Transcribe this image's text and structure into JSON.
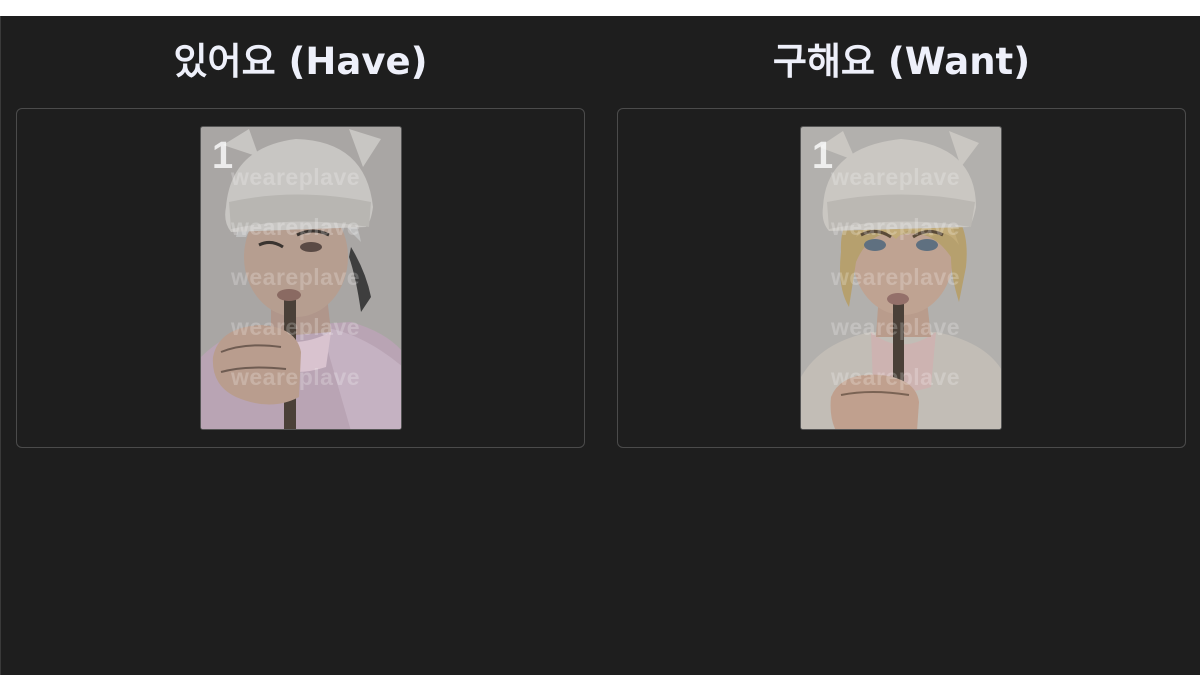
{
  "columns": [
    {
      "title": "있어요 (Have)",
      "cards": [
        {
          "number": "1",
          "watermark": "weareplave",
          "art": "photocard-illustration-silver-hair-beanie"
        }
      ]
    },
    {
      "title": "구해요 (Want)",
      "cards": [
        {
          "number": "1",
          "watermark": "weareplave",
          "art": "photocard-illustration-blonde-hair-beanie"
        }
      ]
    }
  ],
  "colors": {
    "background": "#1e1e1e",
    "title": "#eef0fa",
    "panel_border": "#4b4b4b"
  }
}
